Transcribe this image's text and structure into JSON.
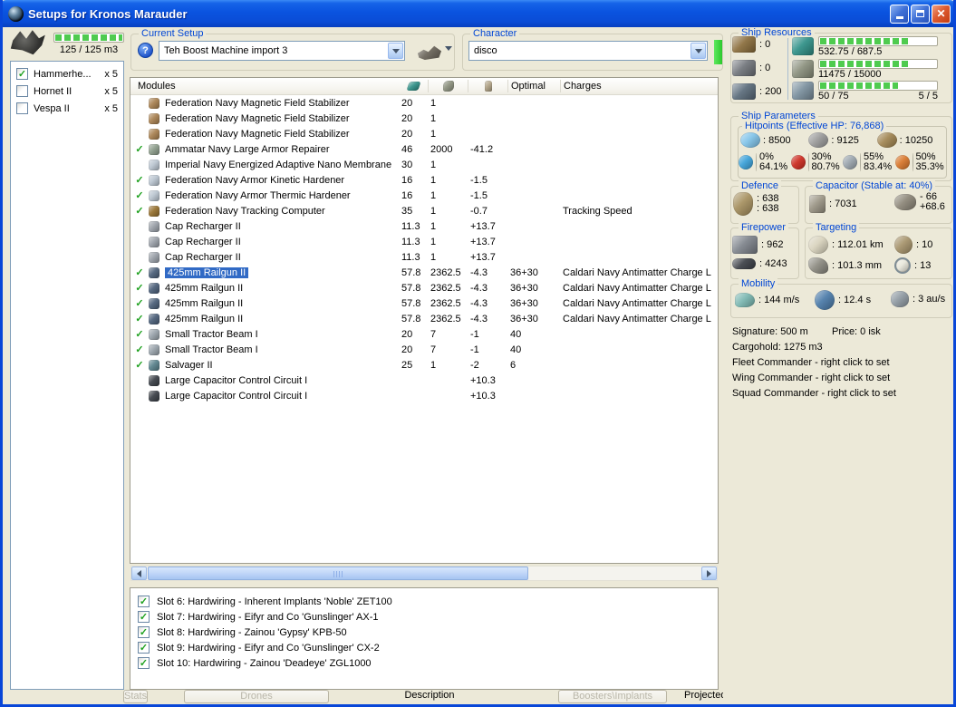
{
  "window": {
    "title": "Setups for Kronos Marauder"
  },
  "drone_bay": {
    "capacity_label": "125 / 125 m3",
    "fill_pct": 100,
    "items": [
      {
        "name": "Hammerhe...",
        "qty": "x 5",
        "checked": true
      },
      {
        "name": "Hornet II",
        "qty": "x 5",
        "checked": false
      },
      {
        "name": "Vespa II",
        "qty": "x 5",
        "checked": false
      }
    ]
  },
  "current_setup": {
    "label": "Current Setup",
    "value": "Teh Boost Machine import 3"
  },
  "character": {
    "label": "Character",
    "value": "disco"
  },
  "ship_resources": {
    "label": "Ship Resources",
    "hardpoints": [
      {
        "icon": "turret-hardpoints-icon",
        "value": ": 0",
        "color": "#8a6d3b"
      },
      {
        "icon": "launcher-hardpoints-icon",
        "value": ": 0",
        "color": "#70747a"
      },
      {
        "icon": "calibration-icon",
        "value": ": 200",
        "color": "#5a6b7a"
      }
    ],
    "bars": [
      {
        "icon": "cpu-icon",
        "color": "#2e8f86",
        "text": "532.75 / 687.5",
        "right": "",
        "pct": 77
      },
      {
        "icon": "powergrid-icon",
        "color": "#8a8f7c",
        "text": "11475 / 15000",
        "right": "",
        "pct": 76
      },
      {
        "icon": "drone-bandwidth-icon",
        "color": "#7a8f9d",
        "text": "50 / 75",
        "right": "5 / 5",
        "pct": 67
      }
    ]
  },
  "modules": {
    "title": "Modules",
    "headers": {
      "optimal": "Optimal",
      "charges": "Charges"
    },
    "rows": [
      {
        "checked": false,
        "selected": false,
        "icon": "#a8804f",
        "name": "Federation Navy Magnetic Field Stabilizer",
        "cpu": "20",
        "pg": "1",
        "cap": "",
        "optimal": "",
        "charges": ""
      },
      {
        "checked": false,
        "selected": false,
        "icon": "#a8804f",
        "name": "Federation Navy Magnetic Field Stabilizer",
        "cpu": "20",
        "pg": "1",
        "cap": "",
        "optimal": "",
        "charges": ""
      },
      {
        "checked": false,
        "selected": false,
        "icon": "#a8804f",
        "name": "Federation Navy Magnetic Field Stabilizer",
        "cpu": "20",
        "pg": "1",
        "cap": "",
        "optimal": "",
        "charges": ""
      },
      {
        "checked": true,
        "selected": false,
        "icon": "#8c9c8a",
        "name": "Ammatar Navy Large Armor Repairer",
        "cpu": "46",
        "pg": "2000",
        "cap": "-41.2",
        "optimal": "",
        "charges": ""
      },
      {
        "checked": false,
        "selected": false,
        "icon": "#b9c4cf",
        "name": "Imperial Navy Energized Adaptive Nano Membrane",
        "cpu": "30",
        "pg": "1",
        "cap": "",
        "optimal": "",
        "charges": ""
      },
      {
        "checked": true,
        "selected": false,
        "icon": "#b9c4cf",
        "name": "Federation Navy Armor Kinetic Hardener",
        "cpu": "16",
        "pg": "1",
        "cap": "-1.5",
        "optimal": "",
        "charges": ""
      },
      {
        "checked": true,
        "selected": false,
        "icon": "#b9c4cf",
        "name": "Federation Navy Armor Thermic Hardener",
        "cpu": "16",
        "pg": "1",
        "cap": "-1.5",
        "optimal": "",
        "charges": ""
      },
      {
        "checked": true,
        "selected": false,
        "icon": "#96702e",
        "name": "Federation Navy Tracking Computer",
        "cpu": "35",
        "pg": "1",
        "cap": "-0.7",
        "optimal": "",
        "charges": "Tracking Speed"
      },
      {
        "checked": false,
        "selected": false,
        "icon": "#9aa0a8",
        "name": "Cap Recharger II",
        "cpu": "11.3",
        "pg": "1",
        "cap": "+13.7",
        "optimal": "",
        "charges": ""
      },
      {
        "checked": false,
        "selected": false,
        "icon": "#9aa0a8",
        "name": "Cap Recharger II",
        "cpu": "11.3",
        "pg": "1",
        "cap": "+13.7",
        "optimal": "",
        "charges": ""
      },
      {
        "checked": false,
        "selected": false,
        "icon": "#9aa0a8",
        "name": "Cap Recharger II",
        "cpu": "11.3",
        "pg": "1",
        "cap": "+13.7",
        "optimal": "",
        "charges": ""
      },
      {
        "checked": true,
        "selected": true,
        "icon": "#4a5e78",
        "name": "425mm Railgun II",
        "cpu": "57.8",
        "pg": "2362.5",
        "cap": "-4.3",
        "optimal": "36+30",
        "charges": "Caldari Navy Antimatter Charge L"
      },
      {
        "checked": true,
        "selected": false,
        "icon": "#4a5e78",
        "name": "425mm Railgun II",
        "cpu": "57.8",
        "pg": "2362.5",
        "cap": "-4.3",
        "optimal": "36+30",
        "charges": "Caldari Navy Antimatter Charge L"
      },
      {
        "checked": true,
        "selected": false,
        "icon": "#4a5e78",
        "name": "425mm Railgun II",
        "cpu": "57.8",
        "pg": "2362.5",
        "cap": "-4.3",
        "optimal": "36+30",
        "charges": "Caldari Navy Antimatter Charge L"
      },
      {
        "checked": true,
        "selected": false,
        "icon": "#4a5e78",
        "name": "425mm Railgun II",
        "cpu": "57.8",
        "pg": "2362.5",
        "cap": "-4.3",
        "optimal": "36+30",
        "charges": "Caldari Navy Antimatter Charge L"
      },
      {
        "checked": true,
        "selected": false,
        "icon": "#98a2aa",
        "name": "Small Tractor Beam I",
        "cpu": "20",
        "pg": "7",
        "cap": "-1",
        "optimal": "40",
        "charges": ""
      },
      {
        "checked": true,
        "selected": false,
        "icon": "#98a2aa",
        "name": "Small Tractor Beam I",
        "cpu": "20",
        "pg": "7",
        "cap": "-1",
        "optimal": "40",
        "charges": ""
      },
      {
        "checked": true,
        "selected": false,
        "icon": "#57808a",
        "name": "Salvager II",
        "cpu": "25",
        "pg": "1",
        "cap": "-2",
        "optimal": "6",
        "charges": ""
      },
      {
        "checked": false,
        "selected": false,
        "icon": "#3a3f46",
        "name": "Large Capacitor Control Circuit I",
        "cpu": "",
        "pg": "",
        "cap": "+10.3",
        "optimal": "",
        "charges": ""
      },
      {
        "checked": false,
        "selected": false,
        "icon": "#3a3f46",
        "name": "Large Capacitor Control Circuit I",
        "cpu": "",
        "pg": "",
        "cap": "+10.3",
        "optimal": "",
        "charges": ""
      }
    ]
  },
  "implants": {
    "slots": [
      {
        "checked": true,
        "label": "Slot 6: Hardwiring - Inherent Implants 'Noble' ZET100"
      },
      {
        "checked": true,
        "label": "Slot 7: Hardwiring - Eifyr and Co 'Gunslinger' AX-1"
      },
      {
        "checked": true,
        "label": "Slot 8: Hardwiring - Zainou 'Gypsy' KPB-50"
      },
      {
        "checked": true,
        "label": "Slot 9: Hardwiring - Eifyr and Co 'Gunslinger' CX-2"
      },
      {
        "checked": true,
        "label": "Slot 10: Hardwiring - Zainou 'Deadeye' ZGL1000"
      }
    ]
  },
  "bottom_tabs": {
    "items": [
      {
        "label": "Drones",
        "button": true
      },
      {
        "label": "Description",
        "button": false
      },
      {
        "label": "Boosters\\Implants",
        "button": true
      },
      {
        "label": "Projected effects",
        "button": false
      },
      {
        "label": "Stats",
        "button": true
      }
    ]
  },
  "ship_parameters": {
    "label": "Ship Parameters",
    "hitpoints": {
      "label": "Hitpoints (Effective HP: 76,868)",
      "pools": [
        {
          "icon": "shield-hp-icon",
          "color": "#7fc2e8",
          "value": ": 8500"
        },
        {
          "icon": "armor-hp-icon",
          "color": "#9a9a9a",
          "value": ": 9125"
        },
        {
          "icon": "structure-hp-icon",
          "color": "#a08450",
          "value": ": 10250"
        }
      ],
      "resists": [
        {
          "icon": "em-resist-icon",
          "color": "#3aa0d8",
          "top": "0%",
          "bottom": "64.1%"
        },
        {
          "icon": "explosive-resist-icon",
          "color": "#cc2a1e",
          "top": "30%",
          "bottom": "80.7%"
        },
        {
          "icon": "kinetic-resist-icon",
          "color": "#9aa4ac",
          "top": "55%",
          "bottom": "83.4%"
        },
        {
          "icon": "thermal-resist-icon",
          "color": "#d8762a",
          "top": "50%",
          "bottom": "35.3%"
        }
      ]
    },
    "defence": {
      "label": "Defence",
      "v1": ": 638",
      "v2": ": 638"
    },
    "capacitor": {
      "label": "Capacitor (Stable at: 40%)",
      "amount": ": 7031",
      "delta_minus": "- 66",
      "delta_plus": "+68.6"
    },
    "firepower": {
      "label": "Firepower",
      "dps": ": 962",
      "volley": ": 4243"
    },
    "targeting": {
      "label": "Targeting",
      "range": ": 112.01 km",
      "max_targets": ": 10",
      "scan_res": ": 101.3 mm",
      "sensor_strength": ": 13"
    },
    "mobility": {
      "label": "Mobility",
      "speed": ": 144 m/s",
      "align_time": ": 12.4 s",
      "warp_speed": ": 3 au/s"
    },
    "info": {
      "signature": "Signature: 500 m",
      "price": "Price: 0 isk",
      "cargohold": "Cargohold: 1275 m3",
      "fleet": "Fleet Commander - right click to set",
      "wing": "Wing Commander - right click to set",
      "squad": "Squad Commander - right click to set"
    }
  }
}
